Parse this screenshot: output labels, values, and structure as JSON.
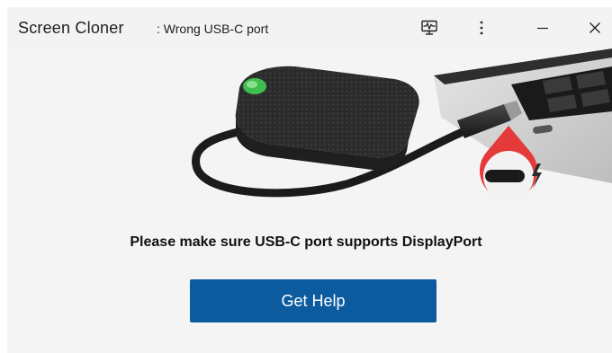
{
  "window": {
    "app_name": "Screen Cloner",
    "status": ": Wrong USB-C port"
  },
  "titlebar_icons": {
    "monitor": "monitor-pulse-icon",
    "more": "more-vertical-icon",
    "minimize": "minimize-icon",
    "close": "close-icon"
  },
  "main": {
    "message": "Please make sure USB-C port supports DisplayPort",
    "help_button_label": "Get Help"
  },
  "colors": {
    "accent": "#0d5b9f",
    "highlight_ring": "#e53a3a",
    "device_led": "#3fbf4f"
  }
}
